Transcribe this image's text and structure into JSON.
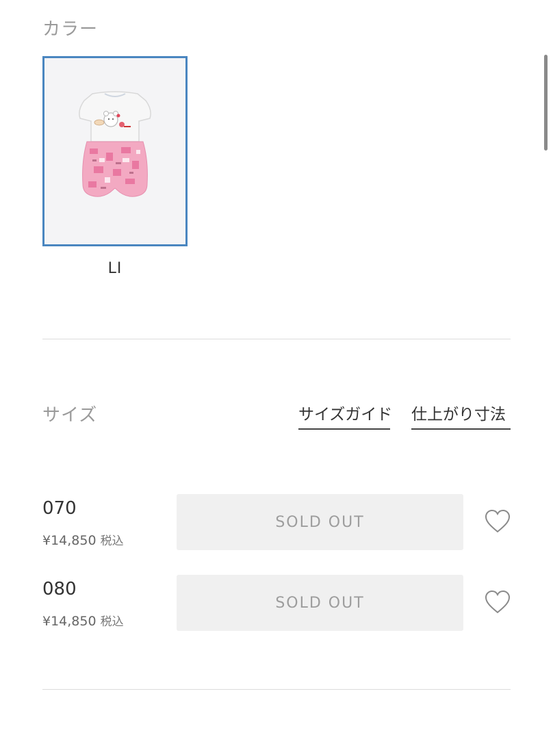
{
  "color_section": {
    "title": "カラー",
    "swatches": [
      {
        "label": "LI",
        "selected": true,
        "image": "baby-romper-pink-print"
      }
    ],
    "selected_border_color": "#4a86c0"
  },
  "size_section": {
    "title": "サイズ",
    "size_guide_label": "サイズガイド",
    "finished_size_label": "仕上がり寸法",
    "rows": [
      {
        "size": "070",
        "price": "¥14,850",
        "tax": "税込",
        "status": "SOLD OUT",
        "icon": "heart-icon"
      },
      {
        "size": "080",
        "price": "¥14,850",
        "tax": "税込",
        "status": "SOLD OUT",
        "icon": "heart-icon"
      }
    ]
  }
}
